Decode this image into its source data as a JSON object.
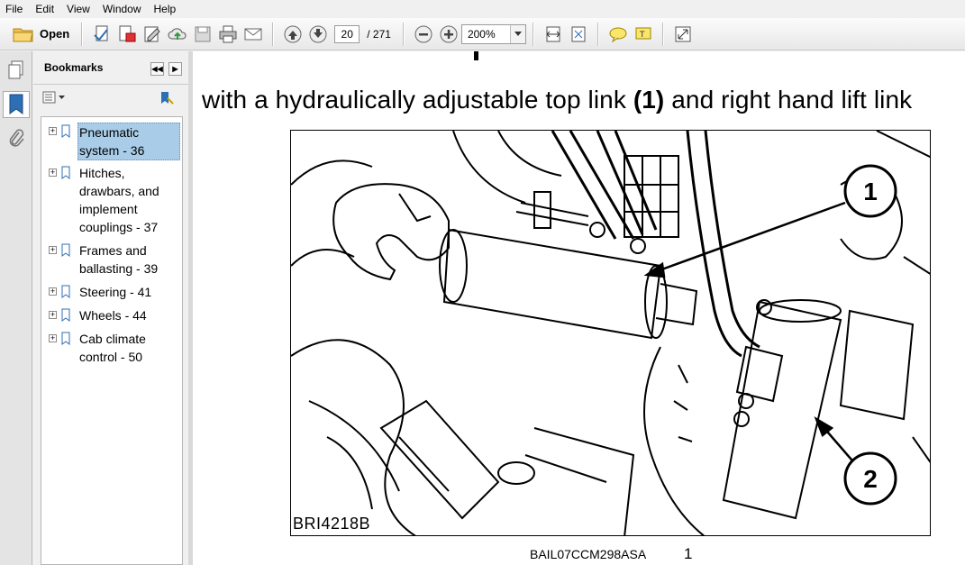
{
  "menubar": {
    "items": [
      "File",
      "Edit",
      "View",
      "Window",
      "Help"
    ]
  },
  "toolbar": {
    "open_label": "Open",
    "current_page": "20",
    "page_total": "/ 271",
    "zoom": "200%",
    "icons": [
      "create-pdf-icon",
      "pdf-edit-icon",
      "sign-icon",
      "upload-cloud-icon",
      "save-icon",
      "print-icon",
      "email-icon",
      "page-up-icon",
      "page-down-icon",
      "zoom-out-icon",
      "zoom-in-icon",
      "fit-width-icon",
      "fit-page-icon",
      "comment-icon",
      "highlight-icon",
      "fullscreen-icon"
    ]
  },
  "bookmarks": {
    "title": "Bookmarks",
    "items": [
      {
        "label": "Pneumatic system - 36",
        "selected": true
      },
      {
        "label": "Hitches, drawbars, and implement couplings - 37",
        "selected": false
      },
      {
        "label": "Frames and ballasting - 39",
        "selected": false
      },
      {
        "label": "Steering - 41",
        "selected": false
      },
      {
        "label": "Wheels - 44",
        "selected": false
      },
      {
        "label": "Cab climate control - 50",
        "selected": false
      }
    ]
  },
  "document": {
    "heading_pre": "with a hydraulically adjustable top link ",
    "heading_bold": "(1)",
    "heading_post": " and right hand lift link",
    "figure_code": "BRI4218B",
    "callout_1": "1",
    "callout_2": "2",
    "figure_ref": "BAIL07CCM298ASA",
    "figure_number": "1"
  },
  "colors": {
    "selection": "#a9cde8",
    "toolbar_bg": "#f0f0f0",
    "accent_blue": "#2c6fb5"
  }
}
